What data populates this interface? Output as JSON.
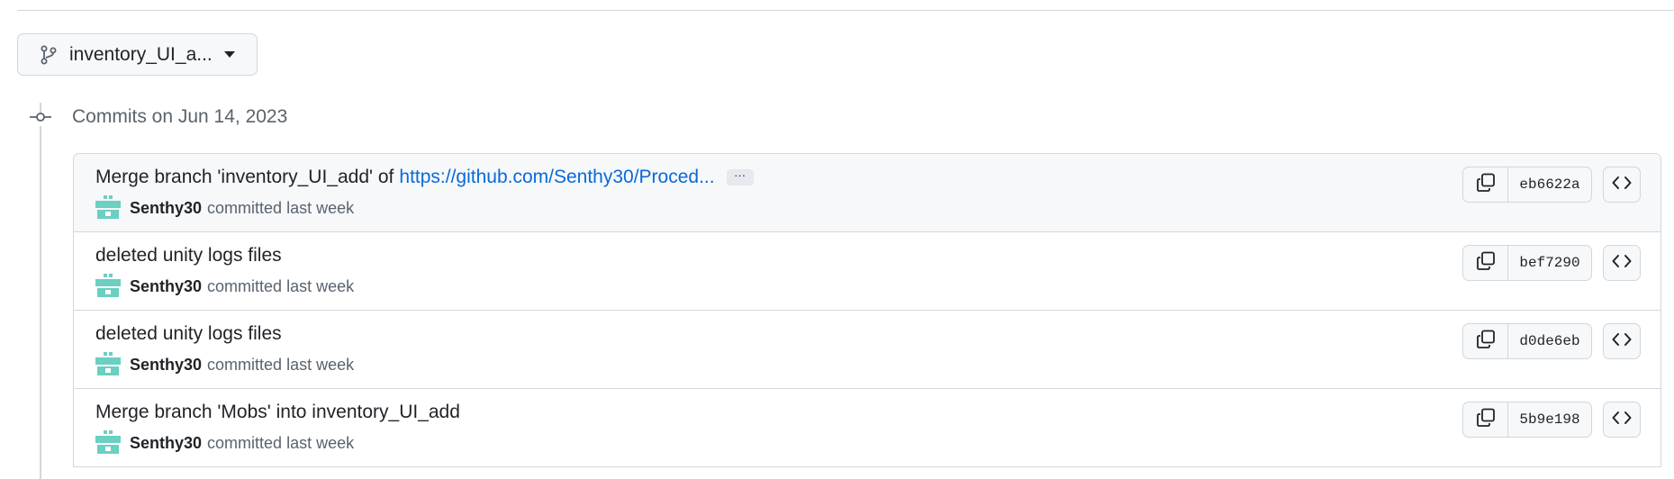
{
  "branch": {
    "label": "inventory_UI_a..."
  },
  "timeline": {
    "heading": "Commits on Jun 14, 2023"
  },
  "commits": [
    {
      "title": "Merge branch 'inventory_UI_add' of",
      "link": "https://github.com/Senthy30/Proced...",
      "ellipsis": "···",
      "author": "Senthy30",
      "when": "committed last week",
      "sha": "eb6622a"
    },
    {
      "title": "deleted unity logs files",
      "author": "Senthy30",
      "when": "committed last week",
      "sha": "bef7290"
    },
    {
      "title": "deleted unity logs files",
      "author": "Senthy30",
      "when": "committed last week",
      "sha": "d0de6eb"
    },
    {
      "title": "Merge branch 'Mobs' into inventory_UI_add",
      "author": "Senthy30",
      "when": "committed last week",
      "sha": "5b9e198"
    }
  ],
  "icons": {
    "branch": "git-branch-icon",
    "caret": "caret-down-icon",
    "node": "git-commit-icon",
    "copy": "copy-icon",
    "browse": "code-icon",
    "avatar": "identicon-avatar"
  },
  "colors": {
    "link": "#0969da",
    "muted": "#59636e",
    "border": "#d0d7de",
    "avatar": "#6bcfc1"
  }
}
